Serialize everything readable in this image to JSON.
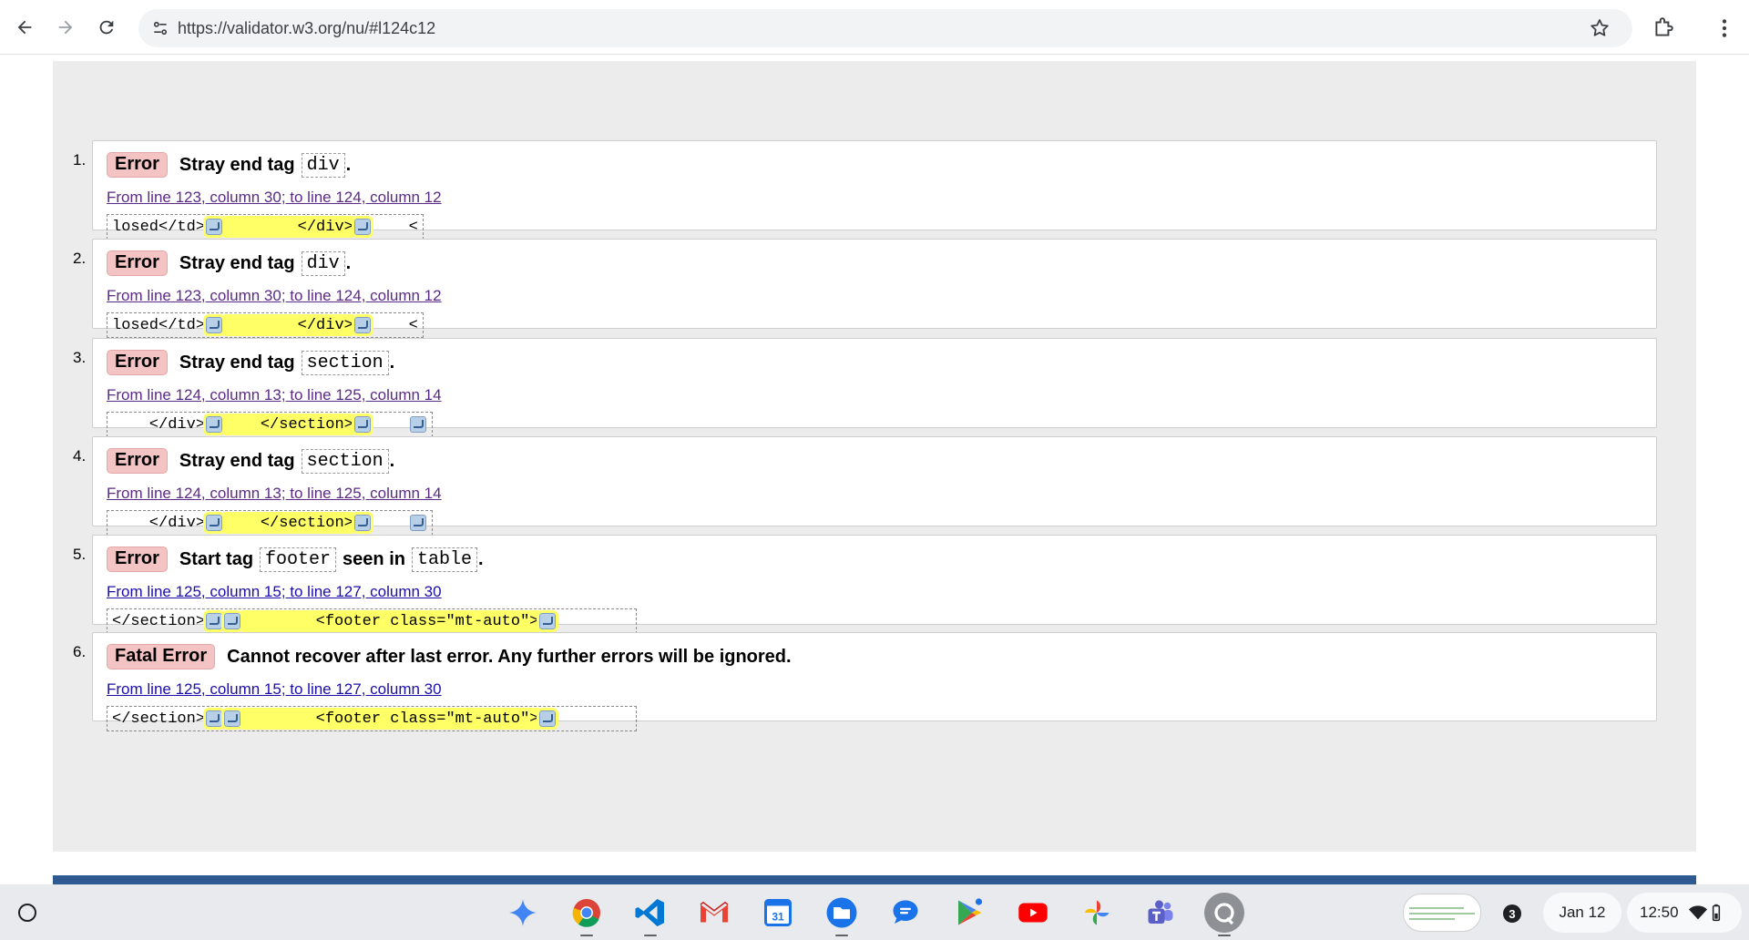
{
  "browser": {
    "url": "https://validator.w3.org/nu/#l124c12"
  },
  "messages": [
    {
      "num": "1.",
      "type": "Error",
      "parts": [
        {
          "t": "Stray end tag"
        },
        {
          "code": "div"
        },
        {
          "t": "."
        }
      ],
      "location": "From line 123, column 30; to line 124, column 12",
      "link_state": "visited",
      "extract": [
        {
          "t": "losed</td>"
        },
        {
          "lf": true
        },
        {
          "hl": "        </div>"
        },
        {
          "lf": true
        },
        {
          "t": "    <"
        }
      ]
    },
    {
      "num": "2.",
      "type": "Error",
      "parts": [
        {
          "t": "Stray end tag"
        },
        {
          "code": "div"
        },
        {
          "t": "."
        }
      ],
      "location": "From line 123, column 30; to line 124, column 12",
      "link_state": "visited",
      "extract": [
        {
          "t": "losed</td>"
        },
        {
          "lf": true
        },
        {
          "hl": "        </div>"
        },
        {
          "lf": true
        },
        {
          "t": "    <"
        }
      ]
    },
    {
      "num": "3.",
      "type": "Error",
      "parts": [
        {
          "t": "Stray end tag"
        },
        {
          "code": "section"
        },
        {
          "t": "."
        }
      ],
      "location": "From line 124, column 13; to line 125, column 14",
      "link_state": "visited",
      "extract": [
        {
          "t": "    </div>"
        },
        {
          "lf": true
        },
        {
          "hl": "    </section>"
        },
        {
          "lf": true
        },
        {
          "t": "    "
        },
        {
          "lf": true
        }
      ]
    },
    {
      "num": "4.",
      "type": "Error",
      "parts": [
        {
          "t": "Stray end tag"
        },
        {
          "code": "section"
        },
        {
          "t": "."
        }
      ],
      "location": "From line 124, column 13; to line 125, column 14",
      "link_state": "visited",
      "extract": [
        {
          "t": "    </div>"
        },
        {
          "lf": true
        },
        {
          "hl": "    </section>"
        },
        {
          "lf": true
        },
        {
          "t": "    "
        },
        {
          "lf": true
        }
      ]
    },
    {
      "num": "5.",
      "type": "Error",
      "parts": [
        {
          "t": "Start tag"
        },
        {
          "code": "footer"
        },
        {
          "t": "seen in"
        },
        {
          "code": "table"
        },
        {
          "t": "."
        }
      ],
      "location": "From line 125, column 15; to line 127, column 30",
      "link_state": "fresh",
      "extract": [
        {
          "t": "</section>"
        },
        {
          "lf": true
        },
        {
          "hl": "    "
        },
        {
          "lf": true
        },
        {
          "hl": "        <footer class=\"mt-auto\">"
        },
        {
          "lf": true
        },
        {
          "t": "        "
        }
      ]
    },
    {
      "num": "6.",
      "type": "Fatal Error",
      "parts": [
        {
          "t": "Cannot recover after last error. Any further errors will be ignored."
        }
      ],
      "location": "From line 125, column 15; to line 127, column 30",
      "link_state": "fresh",
      "extract": [
        {
          "t": "</section>"
        },
        {
          "lf": true
        },
        {
          "hl": "    "
        },
        {
          "lf": true
        },
        {
          "hl": "        <footer class=\"mt-auto\">"
        },
        {
          "lf": true
        },
        {
          "t": "        "
        }
      ]
    }
  ],
  "shelf": {
    "apps": [
      {
        "name": "gemini-icon",
        "color": "#4285f4"
      },
      {
        "name": "chrome-icon",
        "color": "#db4437",
        "open": true
      },
      {
        "name": "vscode-icon",
        "color": "#0078d4",
        "open": true
      },
      {
        "name": "gmail-icon",
        "color": "#ea4335"
      },
      {
        "name": "calendar-icon",
        "color": "#1a73e8",
        "label": "31"
      },
      {
        "name": "files-icon",
        "color": "#1a73e8",
        "open": true
      },
      {
        "name": "messages-icon",
        "color": "#1a73e8"
      },
      {
        "name": "play-store-icon",
        "color": "#34a853"
      },
      {
        "name": "youtube-icon",
        "color": "#ff0000"
      },
      {
        "name": "photos-icon",
        "color": "#fbbc04"
      },
      {
        "name": "teams-icon",
        "color": "#5b5fc7"
      },
      {
        "name": "screen-capture-icon",
        "color": "#5f6368",
        "open": true
      }
    ],
    "notification_count": "3",
    "date": "Jan 12",
    "time": "12:50"
  }
}
